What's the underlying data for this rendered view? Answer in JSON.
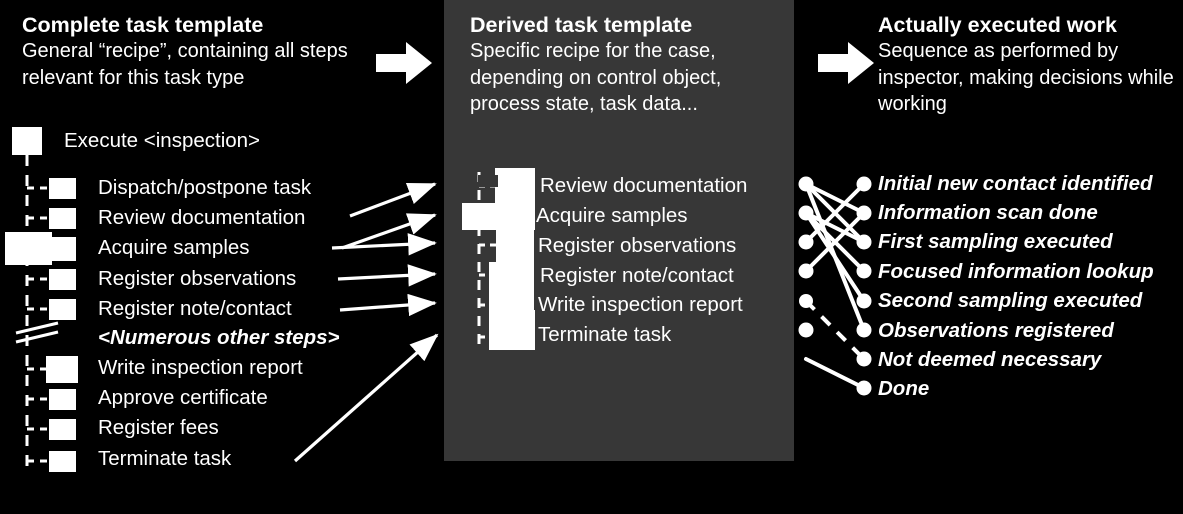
{
  "columns": {
    "left": {
      "title": "Complete task template",
      "subtitle": "General “recipe”, containing all steps relevant for this task type",
      "root": "Execute <inspection>",
      "items": [
        "Dispatch/postpone task",
        "Review documentation",
        "Acquire samples",
        "Register observations",
        "Register note/contact",
        "<Numerous other steps>",
        "Write inspection report",
        "Approve certificate",
        "Register fees",
        "Terminate task"
      ]
    },
    "middle": {
      "title": "Derived task template",
      "subtitle": "Specific recipe for the case, depending on control object, process state, task data...",
      "items": [
        "Review documentation",
        "Acquire samples",
        "Register observations",
        "Register note/contact",
        "Write inspection report",
        "Terminate task"
      ]
    },
    "right": {
      "title": "Actually executed work",
      "subtitle": "Sequence as performed by inspector, making decisions while working",
      "items": [
        "Initial new contact identified",
        "Information scan done",
        "First sampling executed",
        "Focused information lookup",
        "Second sampling executed",
        "Observations registered",
        "Not deemed necessary",
        "Done"
      ]
    }
  },
  "icons": {
    "arrow_left_to_middle": "right-block-arrow",
    "arrow_middle_to_right": "right-block-arrow"
  },
  "colors": {
    "background": "#000000",
    "panel": "#373737",
    "foreground": "#ffffff"
  }
}
